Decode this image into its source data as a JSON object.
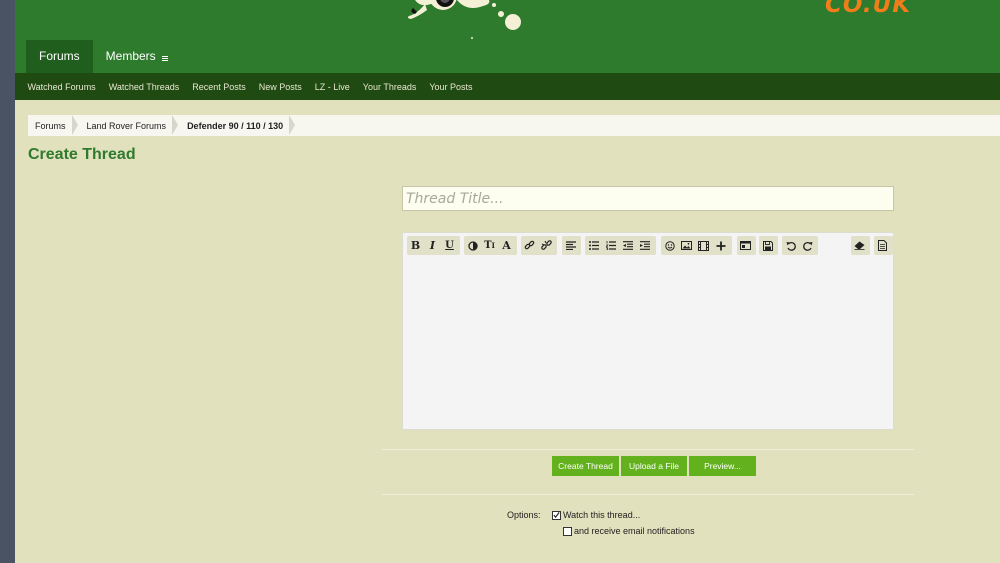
{
  "header": {
    "brand_text": "CO.UK",
    "nav": [
      {
        "label": "Forums"
      },
      {
        "label": "Members"
      }
    ]
  },
  "subnav": [
    {
      "label": "Watched Forums"
    },
    {
      "label": "Watched Threads"
    },
    {
      "label": "Recent Posts"
    },
    {
      "label": "New Posts"
    },
    {
      "label": "LZ - Live"
    },
    {
      "label": "Your Threads"
    },
    {
      "label": "Your Posts"
    }
  ],
  "breadcrumb": [
    {
      "label": "Forums"
    },
    {
      "label": "Land Rover Forums"
    },
    {
      "label": "Defender 90 / 110 / 130"
    }
  ],
  "page": {
    "title": "Create Thread",
    "title_placeholder": "Thread Title...",
    "title_value": ""
  },
  "editor": {
    "icons": [
      "bold-icon",
      "italic-icon",
      "underline-icon",
      "text-color-icon",
      "font-size-icon",
      "font-family-icon",
      "link-icon",
      "unlink-icon",
      "align-icon",
      "bullet-list-icon",
      "numbered-list-icon",
      "outdent-icon",
      "indent-icon",
      "smilie-icon",
      "image-icon",
      "media-icon",
      "insert-icon",
      "code-icon",
      "save-draft-icon",
      "undo-icon",
      "redo-icon",
      "remove-format-icon",
      "toggle-source-icon"
    ]
  },
  "buttons": {
    "create": "Create Thread",
    "upload": "Upload a File",
    "preview": "Preview..."
  },
  "options": {
    "label": "Options:",
    "watch": "Watch this thread...",
    "watch_checked": true,
    "email": "and receive email notifications",
    "email_checked": false
  },
  "colors": {
    "header_green": "#2e7b2e",
    "subnav_dark": "#1f4a12",
    "page_bg": "#e2e1bd",
    "button_green": "#63b21d",
    "brand_orange": "#f07d1a"
  }
}
